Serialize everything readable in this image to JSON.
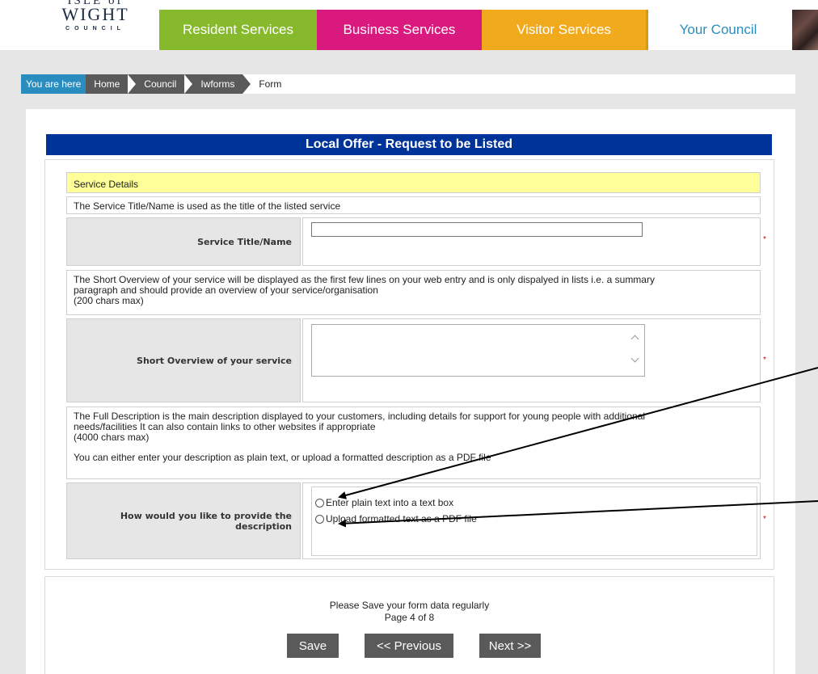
{
  "header": {
    "logo": {
      "line1": "ISLE of",
      "line2": "WIGHT",
      "line3": "COUNCIL"
    },
    "nav": [
      {
        "label": "Resident Services"
      },
      {
        "label": "Business Services"
      },
      {
        "label": "Visitor Services"
      },
      {
        "label": "Your Council"
      }
    ],
    "colors": {
      "resident": "#87b92c",
      "business": "#d9197e",
      "visitor": "#f2aa1d",
      "council_text": "#2a8dbf"
    }
  },
  "breadcrumb": {
    "lead": "You are here",
    "items": [
      "Home",
      "Council",
      "Iwforms"
    ],
    "current": "Form"
  },
  "form": {
    "title": "Local Offer - Request to be Listed",
    "section_heading": "Service Details",
    "info_service_title": "The Service Title/Name is used as the title of the listed service",
    "field_service_title": {
      "label": "Service Title/Name",
      "value": ""
    },
    "info_short_overview": {
      "line1": "The Short Overview of your service will be displayed as the first few lines on your web entry and is only dispalyed in lists i.e. a summary",
      "line2": "paragraph and should provide an overview of your service/organisation",
      "line3": "(200 chars max)"
    },
    "field_short_overview": {
      "label": "Short Overview of your service",
      "value": ""
    },
    "info_full_description": {
      "line1": "The Full Description is the main description displayed to your customers, including details for support for young people with additional",
      "line2": "needs/facilities It can also contain links to other websites if appropriate",
      "line3": "(4000 chars max)",
      "line4": "You can either enter your description as plain text, or upload a formatted description as a PDF file"
    },
    "field_description_method": {
      "label_line1": "How would you like to provide the",
      "label_line2": "description",
      "options": [
        "Enter plain text into a text box",
        "Upload formatted text as a PDF file"
      ]
    },
    "required_mark": "*"
  },
  "footer": {
    "save_note": "Please Save your form data regularly",
    "page_indicator": "Page 4 of 8",
    "buttons": {
      "save": "Save",
      "previous": "<< Previous",
      "next": "Next >>"
    }
  }
}
